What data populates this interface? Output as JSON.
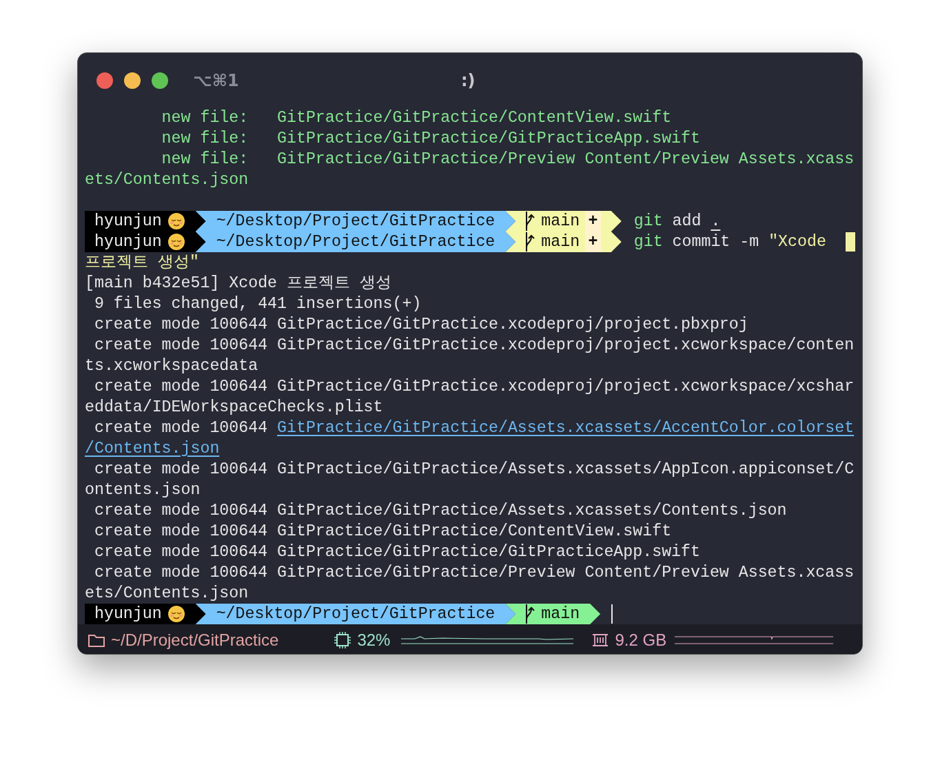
{
  "window": {
    "shortcut": "⌥⌘1",
    "title": ":)"
  },
  "lines": [
    {
      "kind": "output",
      "segments": [
        {
          "text": "        new file:   GitPractice/GitPractice/ContentView.swift",
          "kind": "green"
        }
      ]
    },
    {
      "kind": "output",
      "segments": [
        {
          "text": "        new file:   GitPractice/GitPractice/GitPracticeApp.swift",
          "kind": "green"
        }
      ]
    },
    {
      "kind": "output",
      "segments": [
        {
          "text": "        new file:   GitPractice/GitPractice/Preview Content/Preview Assets.xcass",
          "kind": "green"
        }
      ]
    },
    {
      "kind": "output",
      "segments": [
        {
          "text": "ets/Contents.json",
          "kind": "green"
        }
      ]
    },
    {
      "kind": "blank"
    },
    {
      "kind": "prompt",
      "user": "hyunjun",
      "path": "~/Desktop/Project/GitPractice",
      "branch": "main",
      "dirty": true,
      "status_mark": "+",
      "command": [
        {
          "text": "git",
          "kind": "green"
        },
        {
          "text": " add ",
          "kind": "plain"
        },
        {
          "text": ".",
          "kind": "path"
        }
      ]
    },
    {
      "kind": "prompt",
      "user": "hyunjun",
      "path": "~/Desktop/Project/GitPractice",
      "branch": "main",
      "dirty": true,
      "status_mark": "+",
      "command": [
        {
          "text": "git",
          "kind": "green"
        },
        {
          "text": " commit -m ",
          "kind": "plain"
        },
        {
          "text": "\"Xcode ",
          "kind": "yellow"
        }
      ],
      "cursor": {
        "kind": "block"
      }
    },
    {
      "kind": "output",
      "segments": [
        {
          "text": "프로젝트 생성\"",
          "kind": "yellow"
        }
      ]
    },
    {
      "kind": "output",
      "segments": [
        {
          "text": "[main b432e51] Xcode 프로젝트 생성",
          "kind": "plain"
        }
      ]
    },
    {
      "kind": "output",
      "segments": [
        {
          "text": " 9 files changed, 441 insertions(+)",
          "kind": "plain"
        }
      ]
    },
    {
      "kind": "output",
      "segments": [
        {
          "text": " create mode 100644 GitPractice/GitPractice.xcodeproj/project.pbxproj",
          "kind": "plain"
        }
      ]
    },
    {
      "kind": "output",
      "segments": [
        {
          "text": " create mode 100644 GitPractice/GitPractice.xcodeproj/project.xcworkspace/conten",
          "kind": "plain"
        }
      ]
    },
    {
      "kind": "output",
      "segments": [
        {
          "text": "ts.xcworkspacedata",
          "kind": "plain"
        }
      ]
    },
    {
      "kind": "output",
      "segments": [
        {
          "text": " create mode 100644 GitPractice/GitPractice.xcodeproj/project.xcworkspace/xcshar",
          "kind": "plain"
        }
      ]
    },
    {
      "kind": "output",
      "segments": [
        {
          "text": "eddata/IDEWorkspaceChecks.plist",
          "kind": "plain"
        }
      ]
    },
    {
      "kind": "output",
      "segments": [
        {
          "text": " create mode 100644 ",
          "kind": "plain"
        },
        {
          "text": "GitPractice/GitPractice/Assets.xcassets/AccentColor.colorset",
          "kind": "link"
        }
      ]
    },
    {
      "kind": "output",
      "segments": [
        {
          "text": "/Contents.json",
          "kind": "link"
        }
      ]
    },
    {
      "kind": "output",
      "segments": [
        {
          "text": " create mode 100644 GitPractice/GitPractice/Assets.xcassets/AppIcon.appiconset/C",
          "kind": "plain"
        }
      ]
    },
    {
      "kind": "output",
      "segments": [
        {
          "text": "ontents.json",
          "kind": "plain"
        }
      ]
    },
    {
      "kind": "output",
      "segments": [
        {
          "text": " create mode 100644 GitPractice/GitPractice/Assets.xcassets/Contents.json",
          "kind": "plain"
        }
      ]
    },
    {
      "kind": "output",
      "segments": [
        {
          "text": " create mode 100644 GitPractice/GitPractice/ContentView.swift",
          "kind": "plain"
        }
      ]
    },
    {
      "kind": "output",
      "segments": [
        {
          "text": " create mode 100644 GitPractice/GitPractice/GitPracticeApp.swift",
          "kind": "plain"
        }
      ]
    },
    {
      "kind": "output",
      "segments": [
        {
          "text": " create mode 100644 GitPractice/GitPractice/Preview Content/Preview Assets.xcass",
          "kind": "plain"
        }
      ]
    },
    {
      "kind": "output",
      "segments": [
        {
          "text": "ets/Contents.json",
          "kind": "plain"
        }
      ]
    },
    {
      "kind": "prompt",
      "user": "hyunjun",
      "path": "~/Desktop/Project/GitPractice",
      "branch": "main",
      "dirty": false,
      "cursor": {
        "kind": "bar"
      }
    }
  ],
  "status_bar": {
    "directory": "~/D/Project/GitPractice",
    "cpu": "32%",
    "memory": "9.2 GB"
  }
}
